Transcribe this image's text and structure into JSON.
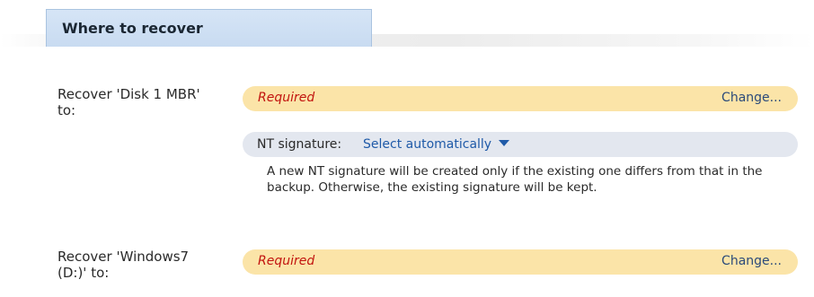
{
  "section": {
    "title": "Where to recover"
  },
  "rows": [
    {
      "label_line1": "Recover 'Disk 1 MBR'",
      "label_line2": "to:",
      "status": "Required",
      "action": "Change..."
    },
    {
      "label_line1": "Recover 'Windows7",
      "label_line2": "(D:)' to:",
      "status": "Required",
      "action": "Change..."
    }
  ],
  "nt_signature": {
    "label": "NT signature:",
    "selected": "Select automatically",
    "description": "A new NT signature will be created only if the existing one differs from that in the backup. Otherwise, the existing signature will be kept."
  },
  "colors": {
    "required_bar": "#fbe4a8",
    "required_text": "#c2140f",
    "nt_bar": "#e3e7ef",
    "link": "#1f5aa8",
    "tab": "#c8dbf1"
  },
  "icons": {
    "dropdown": "chevron-down-icon"
  }
}
